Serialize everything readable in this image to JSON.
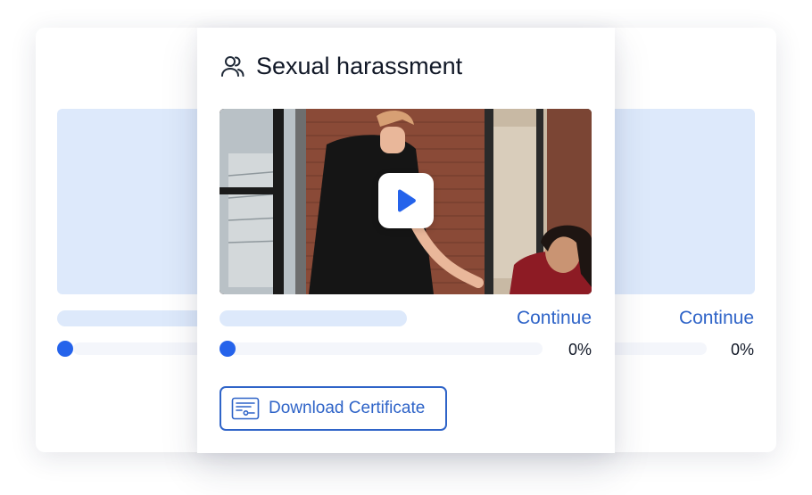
{
  "colors": {
    "accent": "#2563eb",
    "link": "#2f64c8",
    "placeholder": "#dde9fb",
    "track": "#f4f6fb"
  },
  "background_cards": {
    "right": {
      "continue_label": "Continue",
      "progress_text": "0%"
    }
  },
  "course_card": {
    "icon": "users-icon",
    "title": "Sexual harassment",
    "video": {
      "play_icon": "play-icon"
    },
    "continue_label": "Continue",
    "progress": 0,
    "progress_text": "0%",
    "download_button": {
      "icon": "certificate-icon",
      "label": "Download Certificate"
    }
  }
}
